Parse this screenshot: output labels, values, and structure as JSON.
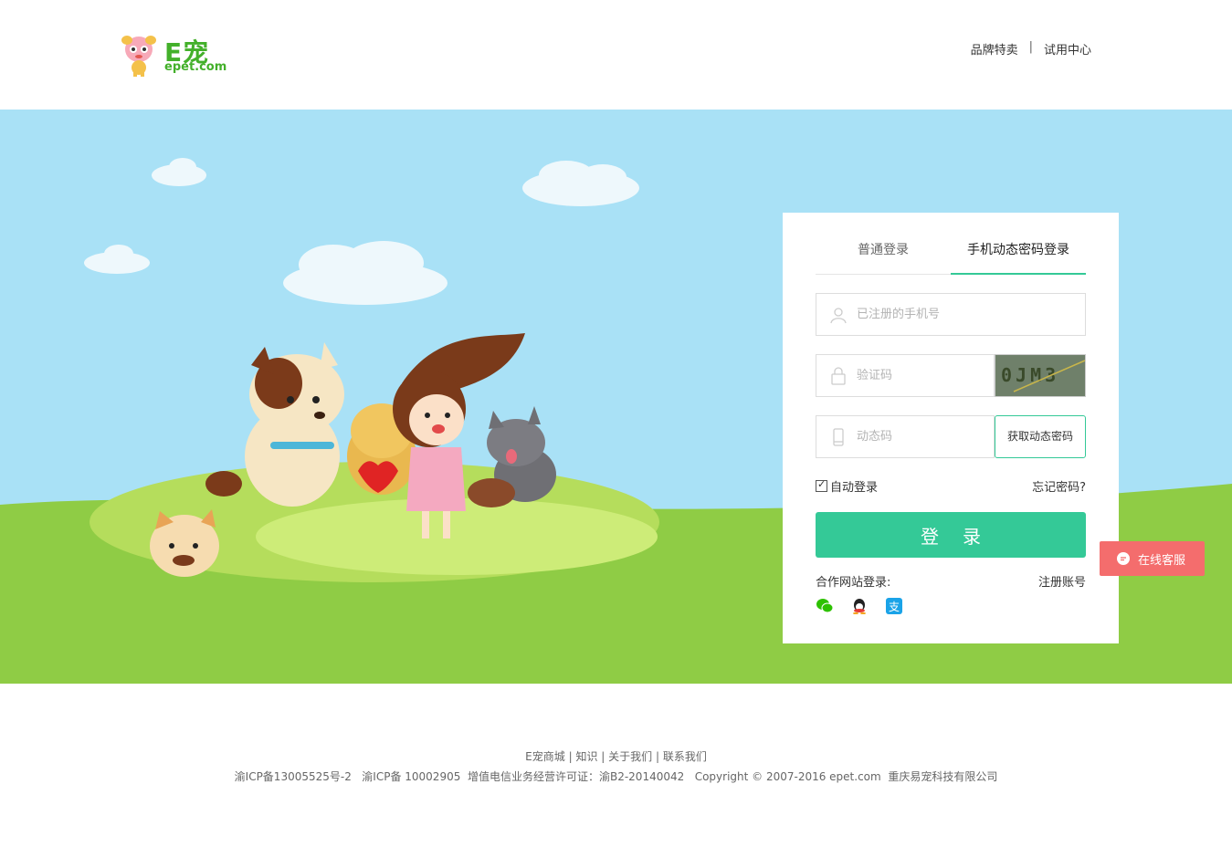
{
  "header": {
    "logo_cn": "E宠",
    "logo_en": "epet.com",
    "nav": [
      {
        "label": "品牌特卖"
      },
      {
        "label": "试用中心"
      }
    ],
    "nav_separator": "|"
  },
  "login": {
    "tabs": [
      {
        "label": "普通登录",
        "active": false
      },
      {
        "label": "手机动态密码登录",
        "active": true
      }
    ],
    "phone_placeholder": "已注册的手机号",
    "captcha_placeholder": "验证码",
    "captcha_text": "0JM3",
    "dynamic_placeholder": "动态码",
    "get_code_label": "获取动态密码",
    "remember_label": "自动登录",
    "remember_checked": true,
    "forgot_label": "忘记密码?",
    "submit_label": "登录",
    "partner_label": "合作网站登录:",
    "register_label": "注册账号",
    "social_icons": [
      "wechat-icon",
      "qq-icon",
      "alipay-icon"
    ]
  },
  "chat": {
    "label": "在线客服"
  },
  "footer": {
    "links": [
      "E宠商城",
      "知识",
      "关于我们",
      "联系我们"
    ],
    "link_separator": " | ",
    "icp": "渝ICP备13005525号-2   渝ICP备 10002905  增值电信业务经营许可证：渝B2-20140042   Copyright © 2007-2016 epet.com  重庆易宠科技有限公司"
  },
  "colors": {
    "brand_green": "#43b02a",
    "accent": "#34c997",
    "sky": "#a9e1f6",
    "grass": "#8fcc45",
    "chat_red": "#f46d6d"
  }
}
